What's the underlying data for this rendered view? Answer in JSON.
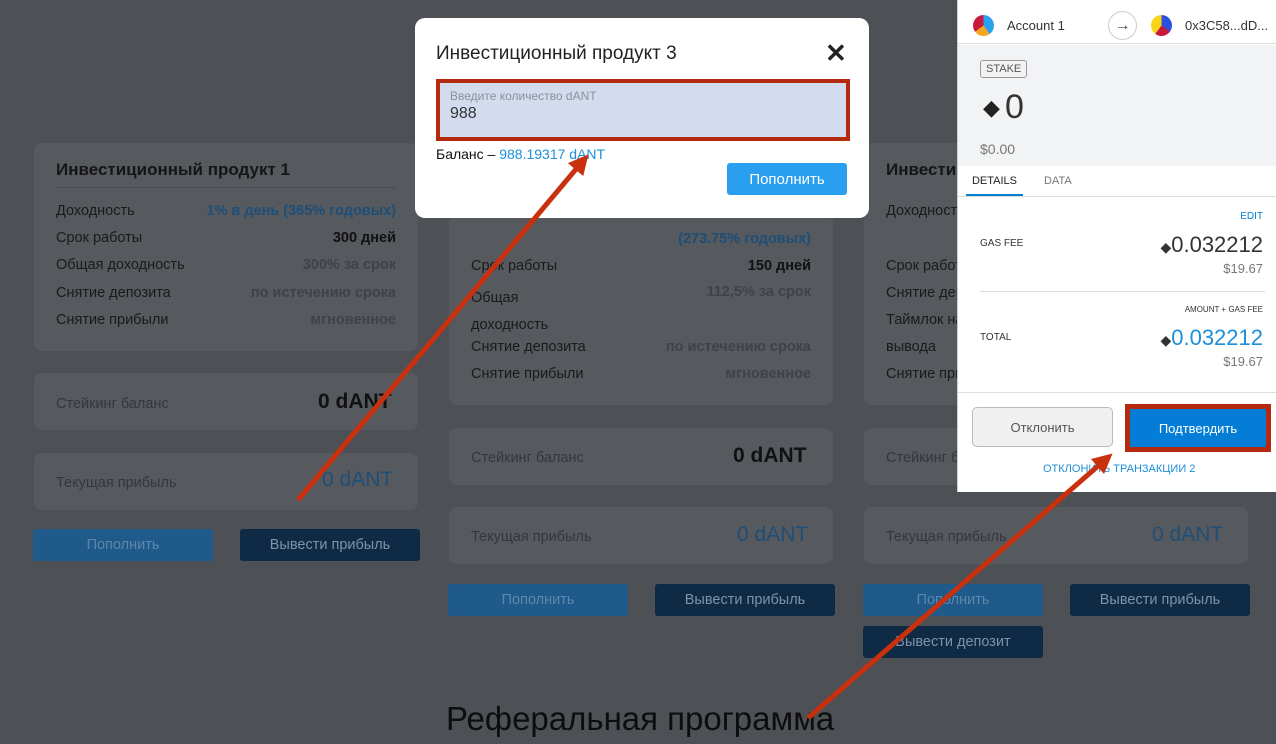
{
  "products": [
    {
      "title": "Инвестиционный продукт 1",
      "rows": [
        [
          "Доходность",
          "1% в день (365% годовых)"
        ],
        [
          "Срок работы",
          "300 дней"
        ],
        [
          "Общая доходность",
          "300% за срок"
        ],
        [
          "Снятие депозита",
          "по истечению срока"
        ],
        [
          "Снятие прибыли",
          "мгновенное"
        ]
      ],
      "staking_label": "Стейкинг баланс",
      "staking_value": "0 dANT",
      "profit_label": "Текущая прибыль",
      "profit_value": "0 dANT",
      "btn_deposit": "Пополнить",
      "btn_withdraw_profit": "Вывести прибыль"
    },
    {
      "rows": [
        [
          "",
          "(273.75% годовых)"
        ],
        [
          "Срок работы",
          "150 дней"
        ],
        [
          "Общая доходность",
          "112,5% за срок"
        ],
        [
          "Снятие депозита",
          "по истечению срока"
        ],
        [
          "Снятие прибыли",
          "мгновенное"
        ]
      ],
      "staking_label": "Стейкинг баланс",
      "staking_value": "0 dANT",
      "profit_label": "Текущая прибыль",
      "profit_value": "0 dANT",
      "btn_deposit": "Пополнить",
      "btn_withdraw_profit": "Вывести прибыль"
    },
    {
      "title": "Инвестиц",
      "rows": [
        "Доходность",
        "Срок работы",
        "Снятие депозита",
        "Таймлок на",
        "вывода",
        "Снятие прибыли"
      ],
      "staking_label": "Стейкинг баланс",
      "profit_label": "Текущая прибыль",
      "profit_value": "0 dANT",
      "btn_deposit": "Пополнить",
      "btn_withdraw_profit": "Вывести прибыль",
      "btn_withdraw_deposit": "Вывести депозит"
    }
  ],
  "referral_title": "Реферальная программа",
  "modal": {
    "title": "Инвестиционный продукт 3",
    "input_label": "Введите количество dANT",
    "input_value": "988",
    "balance_label": "Баланс – ",
    "balance_value": "988.19317 dANT",
    "submit": "Пополнить",
    "close_icon": "close-icon"
  },
  "metamask": {
    "account": "Account 1",
    "recipient": "0x3C58...dD...",
    "badge": "STAKE",
    "amount": "0",
    "amount_usd": "$0.00",
    "tabs": [
      "DETAILS",
      "DATA"
    ],
    "edit": "EDIT",
    "gas_fee_label": "GAS FEE",
    "gas_fee": "0.032212",
    "gas_fee_usd": "$19.67",
    "total_sub": "AMOUNT + GAS FEE",
    "total_label": "TOTAL",
    "total": "0.032212",
    "total_usd": "$19.67",
    "reject": "Отклонить",
    "confirm": "Подтвердить",
    "reject_all": "ОТКЛОНИТЬ ТРАНЗАКЦИИ 2"
  },
  "colors": {
    "highlight": "#b52a0e",
    "primary": "#037dd6",
    "link": "#1c8fd8"
  }
}
